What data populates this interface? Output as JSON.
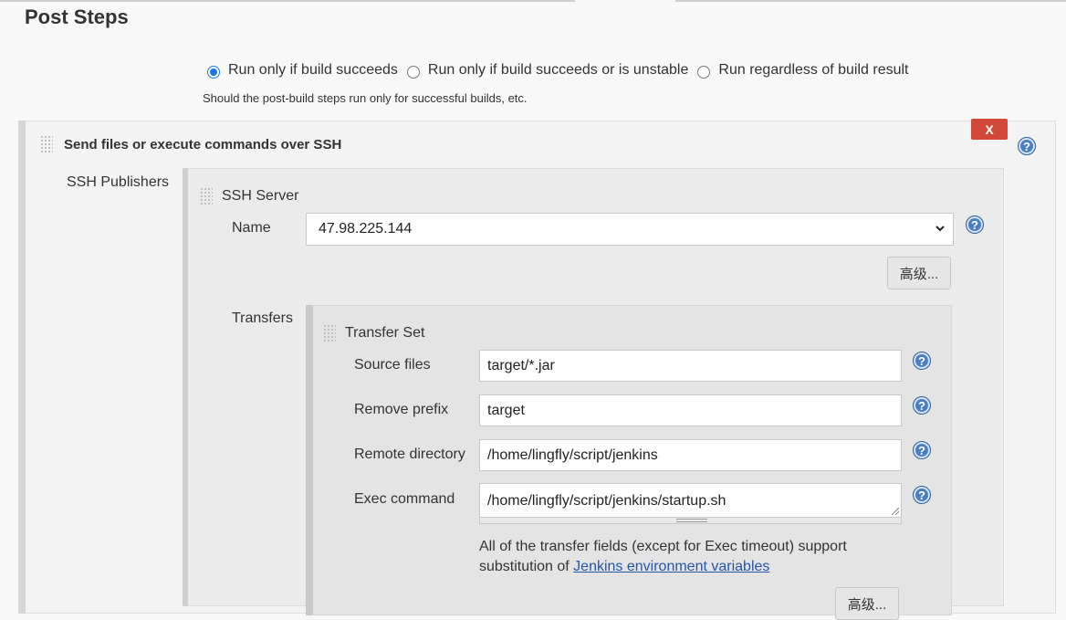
{
  "section": {
    "title": "Post Steps"
  },
  "run_condition": {
    "options": [
      {
        "label": "Run only if build succeeds",
        "checked": true
      },
      {
        "label": "Run only if build succeeds or is unstable",
        "checked": false
      },
      {
        "label": "Run regardless of build result",
        "checked": false
      }
    ],
    "hint": "Should the post-build steps run only for successful builds, etc."
  },
  "ssh_step": {
    "title": "Send files or execute commands over SSH",
    "delete_label": "X",
    "publishers_label": "SSH Publishers",
    "server": {
      "title": "SSH Server",
      "name_label": "Name",
      "name_value": "47.98.225.144",
      "advanced_label": "高级..."
    },
    "transfers": {
      "label": "Transfers",
      "set_title": "Transfer Set",
      "source_files_label": "Source files",
      "source_files_value": "target/*.jar",
      "remove_prefix_label": "Remove prefix",
      "remove_prefix_value": "target",
      "remote_directory_label": "Remote directory",
      "remote_directory_value": "/home/lingfly/script/jenkins",
      "exec_command_label": "Exec command",
      "exec_command_value": "/home/lingfly/script/jenkins/startup.sh",
      "note_text": "All of the transfer fields (except for Exec timeout) support substitution of ",
      "note_link": "Jenkins environment variables",
      "advanced_label": "高级..."
    }
  },
  "icons": {
    "help": "help-icon",
    "grip": "drag-grip-icon",
    "dropdown": "chevron-down-icon"
  },
  "colors": {
    "delete": "#d24939",
    "help": "#4a7fbf",
    "link": "#2356a8",
    "radio": "#1a73e8"
  }
}
